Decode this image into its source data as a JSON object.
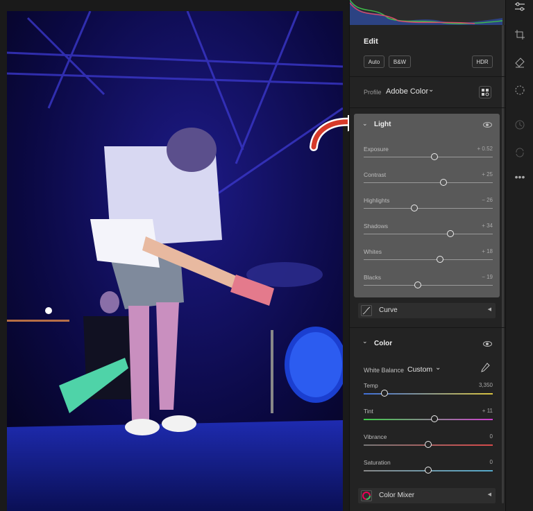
{
  "edit": {
    "title": "Edit",
    "buttons": {
      "auto": "Auto",
      "bw": "B&W",
      "hdr": "HDR"
    },
    "profile_label": "Profile",
    "profile_value": "Adobe Color"
  },
  "light": {
    "title": "Light",
    "sliders": [
      {
        "label": "Exposure",
        "value": "+ 0.52",
        "level": 0.55
      },
      {
        "label": "Contrast",
        "value": "+ 25",
        "level": 0.62
      },
      {
        "label": "Highlights",
        "value": "− 26",
        "level": 0.39
      },
      {
        "label": "Shadows",
        "value": "+ 34",
        "level": 0.67
      },
      {
        "label": "Whites",
        "value": "+ 18",
        "level": 0.59
      },
      {
        "label": "Blacks",
        "value": "− 19",
        "level": 0.42
      }
    ]
  },
  "curve": {
    "title": "Curve"
  },
  "color": {
    "title": "Color",
    "white_balance_label": "White Balance",
    "white_balance_value": "Custom",
    "sliders": [
      {
        "label": "Temp",
        "value": "3,350",
        "level": 0.16,
        "gradient": [
          "#3f6fd8",
          "#d8c23f"
        ]
      },
      {
        "label": "Tint",
        "value": "+ 11",
        "level": 0.55,
        "gradient": [
          "#3fcf4a",
          "#cf3fcf"
        ]
      },
      {
        "label": "Vibrance",
        "value": "0",
        "level": 0.5,
        "gradient": [
          "#777777",
          "#d84a4a"
        ]
      },
      {
        "label": "Saturation",
        "value": "0",
        "level": 0.5,
        "gradient": [
          "#888888",
          "#5ac"
        ]
      }
    ]
  },
  "color_mixer": {
    "title": "Color Mixer"
  },
  "tools": [
    "sliders-icon",
    "crop-icon",
    "eraser-icon",
    "mask-icon",
    "history-icon",
    "sync-icon",
    "more-icon"
  ],
  "colors": {
    "accent_arrow": "#d63a2a",
    "panel": "#232323",
    "light_bg": "#595959"
  }
}
